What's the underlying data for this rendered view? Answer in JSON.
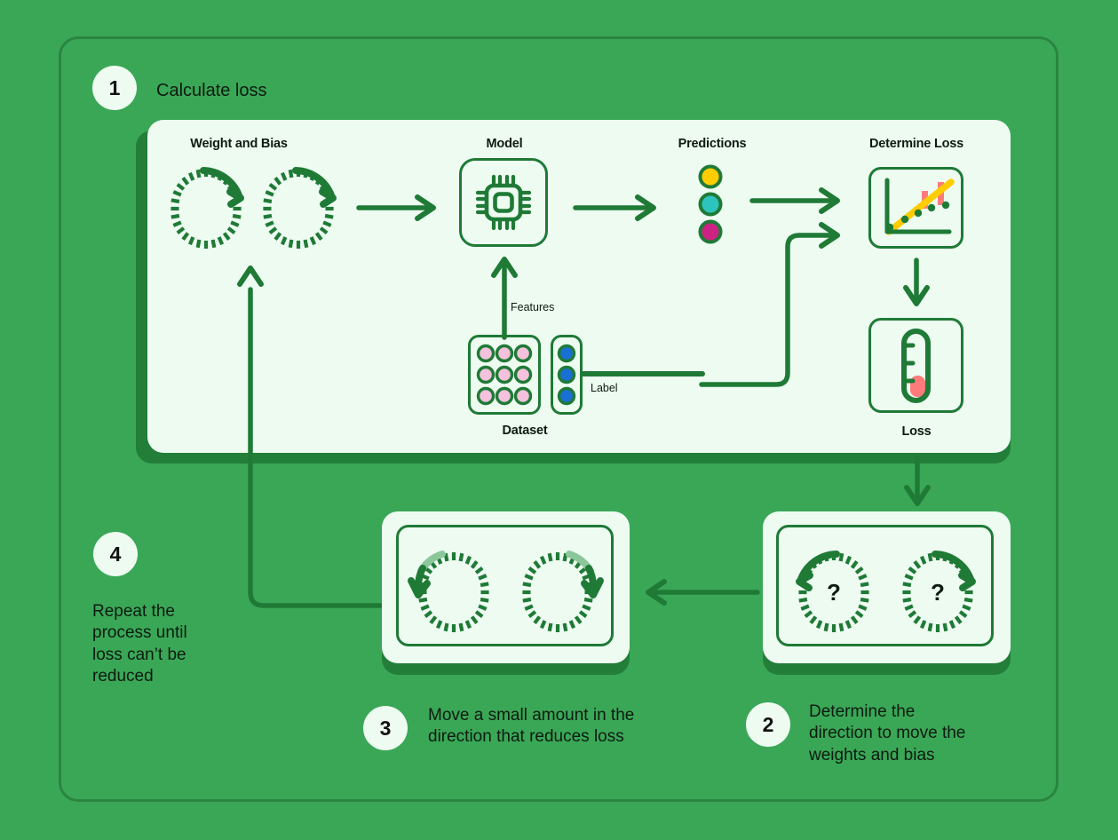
{
  "diagram": {
    "title": "Machine learning training loop (gradient descent)",
    "colors": {
      "background_green": "#3AA757",
      "panel_light": "#EDFBF1",
      "dark_green": "#1F7A36",
      "shadow_green": "#227E38",
      "yellow": "#FFCC00",
      "teal": "#2DC4BE",
      "magenta": "#CC2283",
      "pink_loss": "#FF7A7A",
      "pink_dot": "#F4C2DC",
      "blue_dot": "#1A6FD4",
      "text_dark": "#0D1B10"
    }
  },
  "steps": [
    {
      "number": "1",
      "label": "Calculate loss"
    },
    {
      "number": "2",
      "label": "Determine the direction to move the weights and bias"
    },
    {
      "number": "3",
      "label": "Move a small amount in the direction that reduces loss"
    },
    {
      "number": "4",
      "label": "Repeat the process until loss can’t be reduced"
    }
  ],
  "panel1": {
    "sections": {
      "weight_and_bias": "Weight and Bias",
      "model": "Model",
      "predictions": "Predictions",
      "determine_loss": "Determine Loss",
      "dataset": "Dataset",
      "loss": "Loss"
    },
    "edge_labels": {
      "features": "Features",
      "label": "Label"
    },
    "prediction_dots": [
      "#FFCC00",
      "#2DC4BE",
      "#CC2283"
    ],
    "dataset_feature_dots": [
      "#F4C2DC",
      "#F4C2DC",
      "#F4C2DC",
      "#F4C2DC",
      "#F4C2DC",
      "#F4C2DC",
      "#F4C2DC",
      "#F4C2DC",
      "#F4C2DC"
    ],
    "dataset_label_dots": [
      "#1A6FD4",
      "#1A6FD4",
      "#1A6FD4"
    ]
  },
  "panel2": {
    "dial_left_text": "?",
    "dial_right_text": "?"
  },
  "panel3": {
    "dial_left_text": "",
    "dial_right_text": ""
  }
}
